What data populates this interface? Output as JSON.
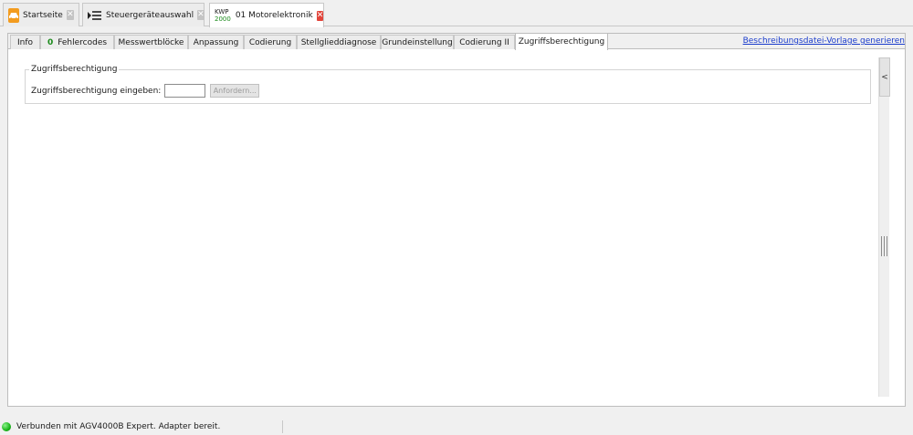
{
  "doc_tabs": [
    {
      "label": "Startseite",
      "icon": "car-icon"
    },
    {
      "label": "Steuergeräteauswahl",
      "icon": "list-icon"
    },
    {
      "label": "01 Motorelektronik",
      "protocol_top": "KWP",
      "protocol_bottom": "2000"
    }
  ],
  "close_glyph": "✕",
  "sub_tabs": {
    "info": "Info",
    "fehlercodes_count": "0",
    "fehlercodes": "Fehlercodes",
    "messwertbloecke": "Messwertblöcke",
    "anpassung": "Anpassung",
    "codierung": "Codierung",
    "stellglieddiagnose": "Stellglieddiagnose",
    "grundeinstellung": "Grundeinstellung",
    "codierung2": "Codierung II",
    "zugriffsberechtigung": "Zugriffsberechtigung"
  },
  "description_link": "Beschreibungsdatei-Vorlage generieren",
  "access_group": {
    "legend": "Zugriffsberechtigung",
    "field_label": "Zugriffsberechtigung eingeben:",
    "input_value": "",
    "button_label": "Anfordern..."
  },
  "side_panel": {
    "collapse_glyph": "<"
  },
  "status": {
    "text": "Verbunden mit AGV4000B Expert. Adapter bereit.",
    "led_color": "#19b519"
  },
  "colors": {
    "accent_orange": "#f39c1f",
    "link_blue": "#1a3ccc",
    "close_red": "#e2443a",
    "count_green": "#1a8a1a"
  }
}
